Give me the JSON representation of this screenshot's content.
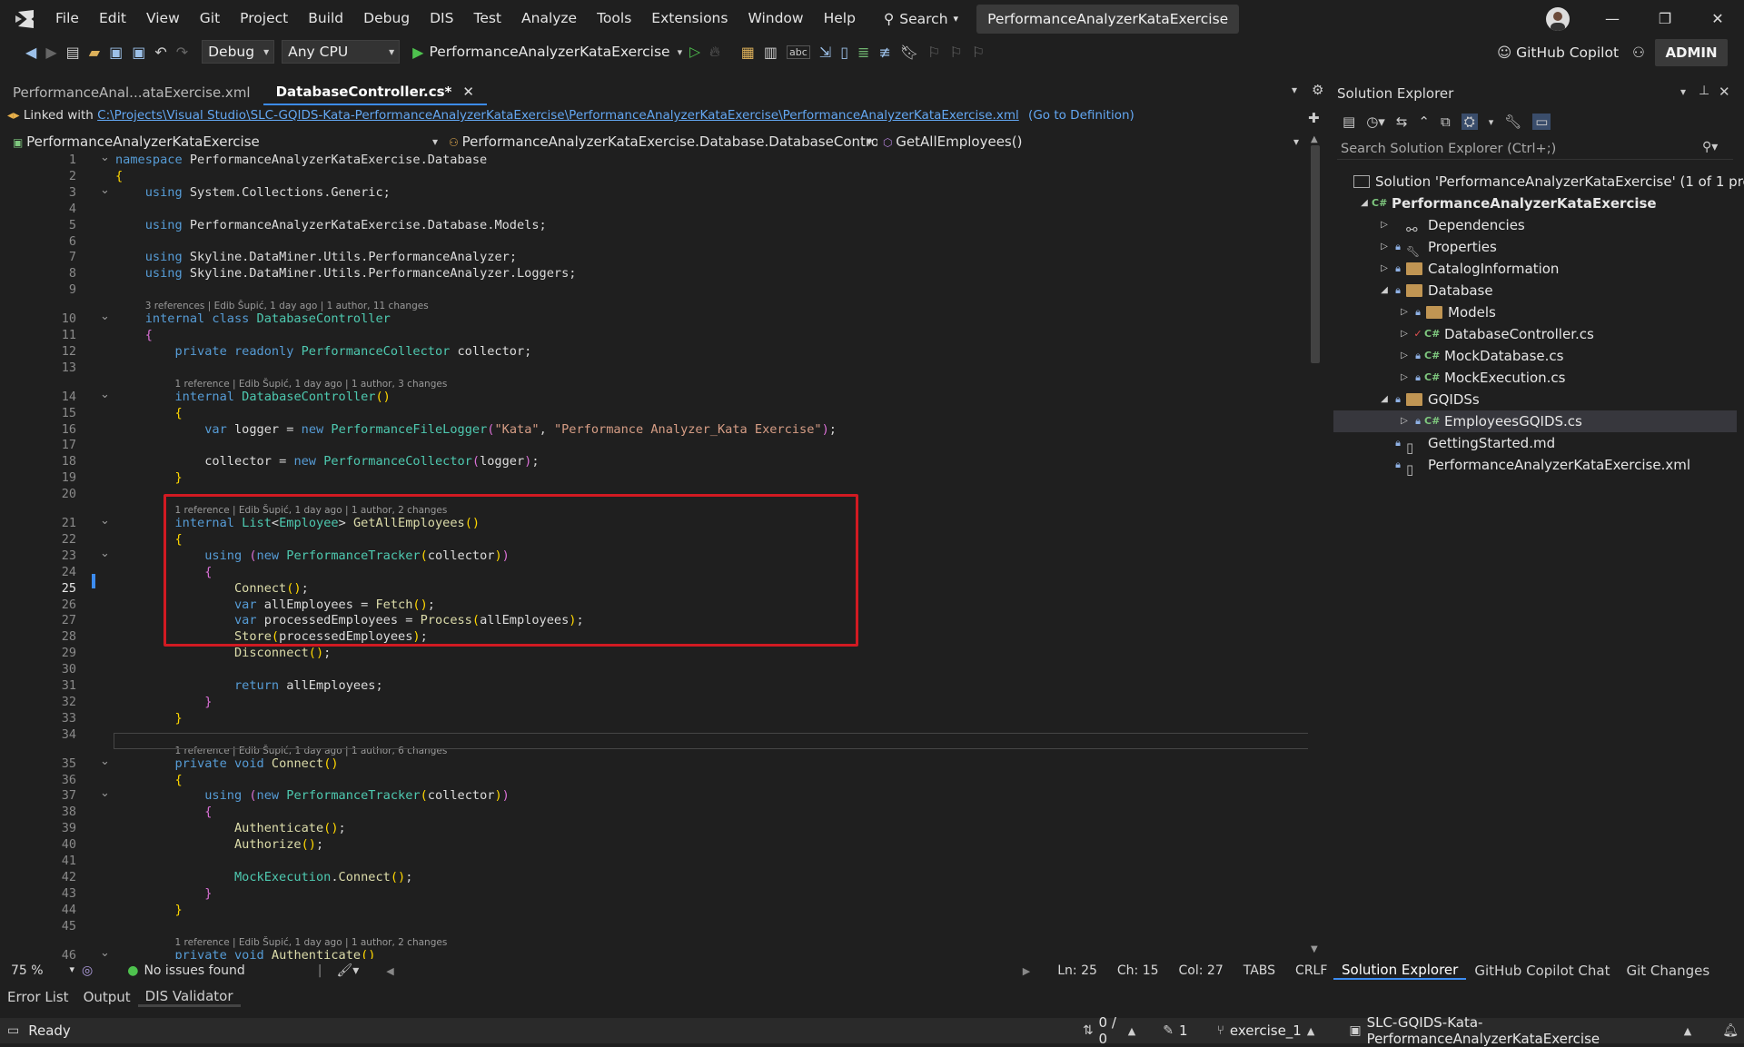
{
  "menu": [
    "File",
    "Edit",
    "View",
    "Git",
    "Project",
    "Build",
    "Debug",
    "DIS",
    "Test",
    "Analyze",
    "Tools",
    "Extensions",
    "Window",
    "Help"
  ],
  "search_label": "Search",
  "solution_title": "PerformanceAnalyzerKataExercise",
  "toolbar": {
    "config": "Debug",
    "platform": "Any CPU",
    "start_target": "PerformanceAnalyzerKataExercise",
    "copilot": "GitHub Copilot",
    "admin": "ADMIN"
  },
  "tabs": [
    {
      "label": "PerformanceAnal...ataExercise.xml"
    },
    {
      "label": "DatabaseController.cs*"
    }
  ],
  "linkbar": {
    "prefix": "Linked with",
    "path": "C:\\Projects\\Visual Studio\\SLC-GQIDS-Kata-PerformanceAnalyzerKataExercise\\PerformanceAnalyzerKataExercise\\PerformanceAnalyzerKataExercise.xml",
    "goto": "(Go to Definition)"
  },
  "nav": {
    "project": "PerformanceAnalyzerKataExercise",
    "class": "PerformanceAnalyzerKataExercise.Database.DatabaseController",
    "member": "GetAllEmployees()"
  },
  "code": {
    "current_line": 25,
    "lens": [
      "3 references | Edib Šupić, 1 day ago | 1 author, 11 changes",
      "1 reference | Edib Šupić, 1 day ago | 1 author, 3 changes",
      "1 reference | Edib Šupić, 1 day ago | 1 author, 2 changes",
      "1 reference | Edib Šupić, 1 day ago | 1 author, 6 changes",
      "1 reference | Edib Šupić, 1 day ago | 1 author, 2 changes"
    ],
    "lines": [
      [
        [
          "kw",
          "namespace "
        ],
        [
          "",
          "PerformanceAnalyzerKataExercise"
        ],
        [
          "pn",
          "."
        ],
        [
          "",
          "Database"
        ]
      ],
      [
        [
          "by",
          "{"
        ]
      ],
      [
        [
          "",
          "    "
        ],
        [
          "kw",
          "using "
        ],
        [
          "",
          "System"
        ],
        [
          "pn",
          "."
        ],
        [
          "",
          "Collections"
        ],
        [
          "pn",
          "."
        ],
        [
          "",
          "Generic"
        ],
        [
          "pn",
          ";"
        ]
      ],
      [],
      [
        [
          "",
          "    "
        ],
        [
          "kw",
          "using "
        ],
        [
          "",
          "PerformanceAnalyzerKataExercise"
        ],
        [
          "pn",
          "."
        ],
        [
          "",
          "Database"
        ],
        [
          "pn",
          "."
        ],
        [
          "",
          "Models"
        ],
        [
          "pn",
          ";"
        ]
      ],
      [],
      [
        [
          "",
          "    "
        ],
        [
          "kw",
          "using "
        ],
        [
          "",
          "Skyline"
        ],
        [
          "pn",
          "."
        ],
        [
          "",
          "DataMiner"
        ],
        [
          "pn",
          "."
        ],
        [
          "",
          "Utils"
        ],
        [
          "pn",
          "."
        ],
        [
          "",
          "PerformanceAnalyzer"
        ],
        [
          "pn",
          ";"
        ]
      ],
      [
        [
          "",
          "    "
        ],
        [
          "kw",
          "using "
        ],
        [
          "",
          "Skyline"
        ],
        [
          "pn",
          "."
        ],
        [
          "",
          "DataMiner"
        ],
        [
          "pn",
          "."
        ],
        [
          "",
          "Utils"
        ],
        [
          "pn",
          "."
        ],
        [
          "",
          "PerformanceAnalyzer"
        ],
        [
          "pn",
          "."
        ],
        [
          "",
          "Loggers"
        ],
        [
          "pn",
          ";"
        ]
      ],
      [],
      [
        [
          "",
          "    "
        ],
        [
          "kw",
          "internal class "
        ],
        [
          "ty",
          "DatabaseController"
        ]
      ],
      [
        [
          "",
          "    "
        ],
        [
          "br",
          "{"
        ]
      ],
      [
        [
          "",
          "        "
        ],
        [
          "kw",
          "private readonly "
        ],
        [
          "ty",
          "PerformanceCollector"
        ],
        [
          "",
          " collector"
        ],
        [
          "pn",
          ";"
        ]
      ],
      [],
      [
        [
          "",
          "        "
        ],
        [
          "kw",
          "internal "
        ],
        [
          "ty",
          "DatabaseController"
        ],
        [
          "by",
          "()"
        ]
      ],
      [
        [
          "",
          "        "
        ],
        [
          "by",
          "{"
        ]
      ],
      [
        [
          "",
          "            "
        ],
        [
          "kw",
          "var "
        ],
        [
          "",
          "logger "
        ],
        [
          "pn",
          "= "
        ],
        [
          "kw",
          "new "
        ],
        [
          "ty",
          "PerformanceFileLogger"
        ],
        [
          "br",
          "("
        ],
        [
          "st",
          "\"Kata\""
        ],
        [
          "pn",
          ", "
        ],
        [
          "st",
          "\"Performance Analyzer_Kata Exercise\""
        ],
        [
          "br",
          ")"
        ],
        [
          "pn",
          ";"
        ]
      ],
      [],
      [
        [
          "",
          "            "
        ],
        [
          "",
          "collector "
        ],
        [
          "pn",
          "= "
        ],
        [
          "kw",
          "new "
        ],
        [
          "ty",
          "PerformanceCollector"
        ],
        [
          "br",
          "("
        ],
        [
          "",
          "logger"
        ],
        [
          "br",
          ")"
        ],
        [
          "pn",
          ";"
        ]
      ],
      [
        [
          "",
          "        "
        ],
        [
          "by",
          "}"
        ]
      ],
      [],
      [
        [
          "",
          "        "
        ],
        [
          "kw",
          "internal "
        ],
        [
          "ty",
          "List"
        ],
        [
          "pn",
          "<"
        ],
        [
          "ty",
          "Employee"
        ],
        [
          "pn",
          "> "
        ],
        [
          "mt",
          "GetAllEmployees"
        ],
        [
          "by",
          "()"
        ]
      ],
      [
        [
          "",
          "        "
        ],
        [
          "by",
          "{"
        ]
      ],
      [
        [
          "",
          "            "
        ],
        [
          "kw",
          "using "
        ],
        [
          "br",
          "("
        ],
        [
          "kw",
          "new "
        ],
        [
          "ty",
          "PerformanceTracker"
        ],
        [
          "by",
          "("
        ],
        [
          "",
          "collector"
        ],
        [
          "by",
          ")"
        ],
        [
          "br",
          ")"
        ]
      ],
      [
        [
          "",
          "            "
        ],
        [
          "br",
          "{"
        ]
      ],
      [
        [
          "",
          "                "
        ],
        [
          "mt",
          "Connect"
        ],
        [
          "by",
          "()"
        ],
        [
          "pn",
          ";"
        ]
      ],
      [
        [
          "",
          "                "
        ],
        [
          "kw",
          "var "
        ],
        [
          "",
          "allEmployees "
        ],
        [
          "pn",
          "= "
        ],
        [
          "mt",
          "Fetch"
        ],
        [
          "by",
          "()"
        ],
        [
          "pn",
          ";"
        ]
      ],
      [
        [
          "",
          "                "
        ],
        [
          "kw",
          "var "
        ],
        [
          "",
          "processedEmployees "
        ],
        [
          "pn",
          "= "
        ],
        [
          "mt",
          "Process"
        ],
        [
          "by",
          "("
        ],
        [
          "",
          "allEmployees"
        ],
        [
          "by",
          ")"
        ],
        [
          "pn",
          ";"
        ]
      ],
      [
        [
          "",
          "                "
        ],
        [
          "mt",
          "Store"
        ],
        [
          "by",
          "("
        ],
        [
          "",
          "processedEmployees"
        ],
        [
          "by",
          ")"
        ],
        [
          "pn",
          ";"
        ]
      ],
      [
        [
          "",
          "                "
        ],
        [
          "mt",
          "Disconnect"
        ],
        [
          "by",
          "()"
        ],
        [
          "pn",
          ";"
        ]
      ],
      [],
      [
        [
          "",
          "                "
        ],
        [
          "kw",
          "return "
        ],
        [
          "",
          "allEmployees"
        ],
        [
          "pn",
          ";"
        ]
      ],
      [
        [
          "",
          "            "
        ],
        [
          "br",
          "}"
        ]
      ],
      [
        [
          "",
          "        "
        ],
        [
          "by",
          "}"
        ]
      ],
      [],
      [
        [
          "",
          "        "
        ],
        [
          "kw",
          "private void "
        ],
        [
          "mt",
          "Connect"
        ],
        [
          "by",
          "()"
        ]
      ],
      [
        [
          "",
          "        "
        ],
        [
          "by",
          "{"
        ]
      ],
      [
        [
          "",
          "            "
        ],
        [
          "kw",
          "using "
        ],
        [
          "br",
          "("
        ],
        [
          "kw",
          "new "
        ],
        [
          "ty",
          "PerformanceTracker"
        ],
        [
          "by",
          "("
        ],
        [
          "",
          "collector"
        ],
        [
          "by",
          ")"
        ],
        [
          "br",
          ")"
        ]
      ],
      [
        [
          "",
          "            "
        ],
        [
          "br",
          "{"
        ]
      ],
      [
        [
          "",
          "                "
        ],
        [
          "mt",
          "Authenticate"
        ],
        [
          "by",
          "()"
        ],
        [
          "pn",
          ";"
        ]
      ],
      [
        [
          "",
          "                "
        ],
        [
          "mt",
          "Authorize"
        ],
        [
          "by",
          "()"
        ],
        [
          "pn",
          ";"
        ]
      ],
      [],
      [
        [
          "",
          "                "
        ],
        [
          "ty",
          "MockExecution"
        ],
        [
          "pn",
          "."
        ],
        [
          "mt",
          "Connect"
        ],
        [
          "by",
          "()"
        ],
        [
          "pn",
          ";"
        ]
      ],
      [
        [
          "",
          "            "
        ],
        [
          "br",
          "}"
        ]
      ],
      [
        [
          "",
          "        "
        ],
        [
          "by",
          "}"
        ]
      ],
      [],
      [
        [
          "",
          "        "
        ],
        [
          "kw",
          "private void "
        ],
        [
          "mt",
          "Authenticate"
        ],
        [
          "by",
          "()"
        ]
      ]
    ]
  },
  "editor_status": {
    "zoom": "75 %",
    "issues": "No issues found",
    "ln": "Ln: 25",
    "ch": "Ch: 15",
    "col": "Col: 27",
    "tabs": "TABS",
    "eol": "CRLF"
  },
  "solution_explorer": {
    "title": "Solution Explorer",
    "search_placeholder": "Search Solution Explorer (Ctrl+;)",
    "items": [
      {
        "label": "Solution 'PerformanceAnalyzerKataExercise' (1 of 1 project)",
        "type": "solution"
      },
      {
        "label": "PerformanceAnalyzerKataExercise",
        "type": "project"
      },
      {
        "label": "Dependencies",
        "type": "deps"
      },
      {
        "label": "Properties",
        "type": "props"
      },
      {
        "label": "CatalogInformation",
        "type": "folder"
      },
      {
        "label": "Database",
        "type": "folder"
      },
      {
        "label": "Models",
        "type": "folder"
      },
      {
        "label": "DatabaseController.cs",
        "type": "cs"
      },
      {
        "label": "MockDatabase.cs",
        "type": "cs"
      },
      {
        "label": "MockExecution.cs",
        "type": "cs"
      },
      {
        "label": "GQIDSs",
        "type": "folder"
      },
      {
        "label": "EmployeesGQIDS.cs",
        "type": "cs"
      },
      {
        "label": "GettingStarted.md",
        "type": "file"
      },
      {
        "label": "PerformanceAnalyzerKataExercise.xml",
        "type": "file"
      }
    ],
    "tabs": [
      "Solution Explorer",
      "GitHub Copilot Chat",
      "Git Changes"
    ]
  },
  "bottom_tabs": [
    "Error List",
    "Output",
    "DIS Validator"
  ],
  "statusbar": {
    "ready": "Ready",
    "changes": "0 / 0",
    "edits": "1",
    "branch": "exercise_1",
    "repo": "SLC-GQIDS-Kata-PerformanceAnalyzerKataExercise"
  }
}
